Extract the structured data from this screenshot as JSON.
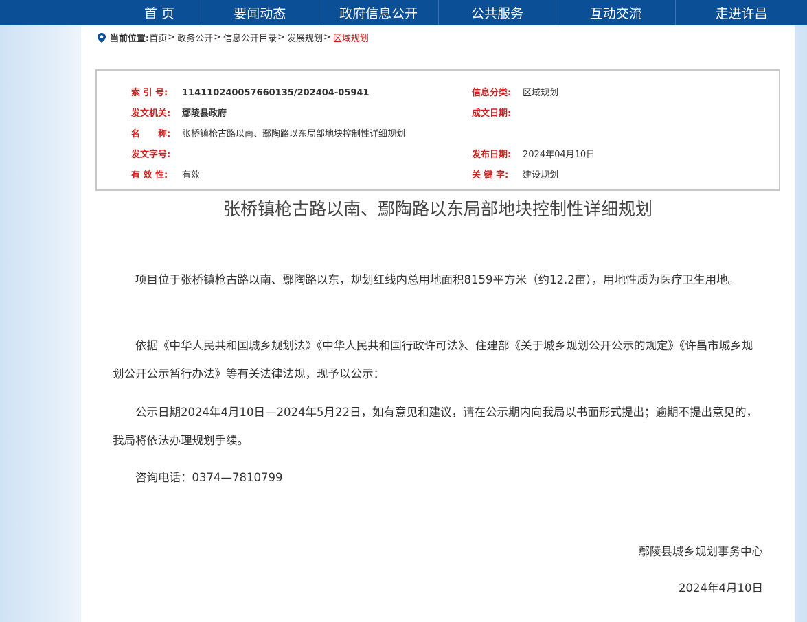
{
  "nav": {
    "items": [
      "首 页",
      "要闻动态",
      "政府信息公开",
      "公共服务",
      "互动交流",
      "走进许昌"
    ]
  },
  "breadcrumb": {
    "label": "当前位置:",
    "items": [
      "首页",
      "政务公开",
      "信息公开目录",
      "发展规划"
    ],
    "separator": ">",
    "current": "区域规划"
  },
  "info": {
    "index_label": "索 引 号:",
    "index_value": "114110240057660135/202404-05941",
    "category_label": "信息分类:",
    "category_value": "区域规划",
    "issuer_label": "发文机关:",
    "issuer_value": "鄢陵县政府",
    "written_date_label": "成文日期:",
    "written_date_value": "",
    "name_label": "名　　称:",
    "name_value": "张桥镇枪古路以南、鄢陶路以东局部地块控制性详细规划",
    "doc_number_label": "发文字号:",
    "doc_number_value": "",
    "publish_date_label": "发布日期:",
    "publish_date_value": "2024年04月10日",
    "validity_label": "有 效 性:",
    "validity_value": "有效",
    "keywords_label": "关 键 字:",
    "keywords_value": "建设规划"
  },
  "article": {
    "title": "张桥镇枪古路以南、鄢陶路以东局部地块控制性详细规划",
    "paragraphs": [
      "项目位于张桥镇枪古路以南、鄢陶路以东，规划红线内总用地面积8159平方米（约12.2亩），用地性质为医疗卫生用地。",
      "依据《中华人民共和国城乡规划法》《中华人民共和国行政许可法》、住建部《关于城乡规划公开公示的规定》《许昌市城乡规划公开公示暂行办法》等有关法律法规，现予以公示：",
      "公示日期2024年4月10日—2024年5月22日，如有意见和建议，请在公示期内向我局以书面形式提出；逾期不提出意见的，我局将依法办理规划手续。",
      "咨询电话：0374—7810799"
    ],
    "signature": "鄢陵县城乡规划事务中心",
    "date": "2024年4月10日"
  },
  "colors": {
    "nav_bg": "#0b4f96",
    "label_red": "#d21f1f",
    "current_red": "#d01f1f"
  }
}
